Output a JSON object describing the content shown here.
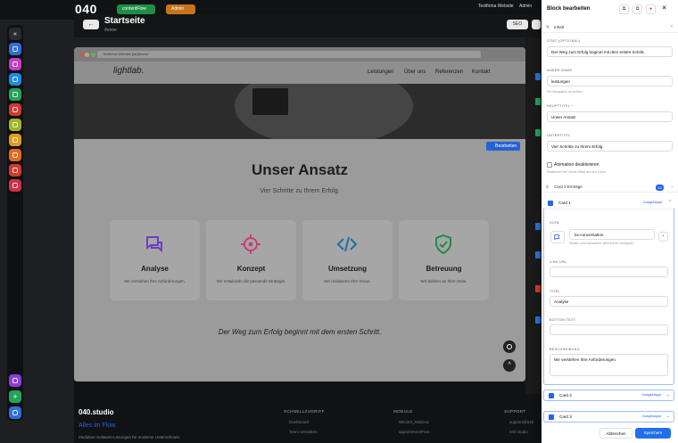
{
  "app": {
    "logo": "040",
    "brand_pill": "contentFlow",
    "mode_pill": "Admin",
    "workspace": "Testfirma Website",
    "user": "Admin"
  },
  "page": {
    "title": "Startseite",
    "path": "/home",
    "seo_label": "SEO"
  },
  "browser": {
    "url": "Testfirma Website (de)/home"
  },
  "site": {
    "logo": "lightlab.",
    "nav": [
      "Leistungen",
      "Über uns",
      "Referenzen",
      "Kontakt"
    ],
    "edit_label": "Bearbeiten",
    "section_title": "Unser Ansatz",
    "section_sub": "Vier Schritte zu Ihrem Erfolg.",
    "cards": [
      {
        "title": "Analyse",
        "desc": "Wir verstehen Ihre Anforderungen."
      },
      {
        "title": "Konzept",
        "desc": "Wir entwickeln die passende Strategie."
      },
      {
        "title": "Umsetzung",
        "desc": "Wir realisieren Ihre Vision."
      },
      {
        "title": "Betreuung",
        "desc": "Wir bleiben an Ihrer Seite."
      }
    ],
    "quote": "Der Weg zum Erfolg beginnt mit dem ersten Schritt."
  },
  "footer": {
    "brand": "040.studio",
    "tagline": "Alles im Flow.",
    "desc": "Modulare Software-Lösungen für moderne Unternehmen.",
    "col1_title": "SCHNELLZUGRIFF",
    "col1": [
      "Dashboard",
      "Team verwalten"
    ],
    "col2_title": "MODULE",
    "col2": [
      "NEUES_MODUL",
      "appointmentFlow"
    ],
    "col3_title": "SUPPORT",
    "col3": [
      "support@040",
      "040.studio"
    ]
  },
  "panel": {
    "title": "Block bearbeiten",
    "section_content": "Inhalt",
    "zitat_label": "ZITAT (OPTIONAL)",
    "zitat_value": "Der Weg zum Erfolg beginnt mit dem ersten Schritt.",
    "anker_label": "ANKER-NAME",
    "anker_value": "leistungen",
    "anker_hint": "Für Navigation via Ankern",
    "haupt_label": "HAUPTTITEL *",
    "haupt_value": "Unser Ansatz",
    "unter_label": "UNTERTITEL",
    "unter_value": "Vier Schritte zu Ihrem Erfolg.",
    "anim_label": "Animation deaktivieren",
    "anim_hint": "Deaktiviert den Scroll-Effekt auf den Cards",
    "cards_label": "Card 1-Einträge",
    "cards_count": "10",
    "card1": {
      "label": "Card 1",
      "status": "Ausgeklappt",
      "icon_label": "ICON",
      "icon_value": "bx-conversation",
      "icon_hint": "Klicken zum Auswählen (Bild immer verfügbar)",
      "link_label": "LINK URL",
      "titel_label": "TITEL",
      "titel_value": "Analyse",
      "button_label": "BUTTON TEXT",
      "beschr_label": "BESCHREIBUNG",
      "beschr_value": "Wir verstehen Ihre Anforderungen."
    },
    "card2": {
      "label": "Card 2",
      "status": "Ausgeklappt"
    },
    "card3": {
      "label": "Card 3",
      "status": "Ausgeklappt"
    },
    "cancel": "Abbrechen",
    "save": "Speichern"
  }
}
